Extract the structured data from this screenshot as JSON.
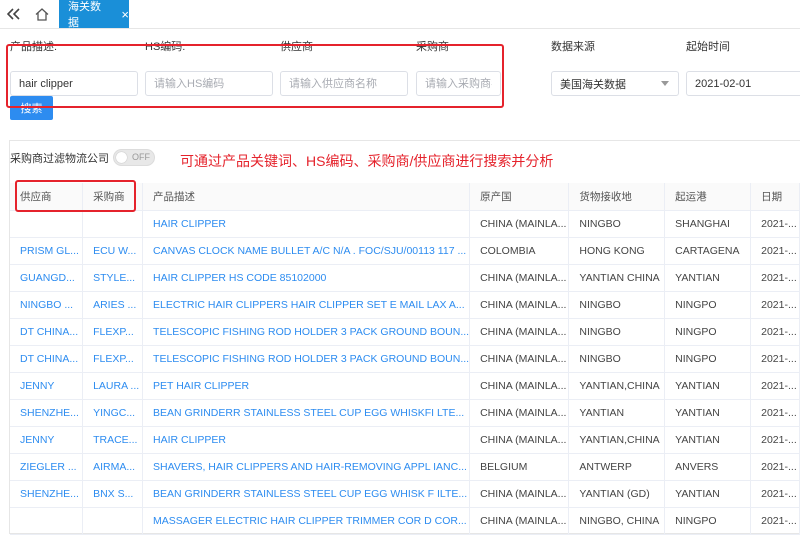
{
  "tabs": {
    "active_label": "海关数据",
    "close_glyph": "×"
  },
  "form": {
    "product_desc_label": "产品描述:",
    "hs_label": "HS编码:",
    "supplier_label": "供应商",
    "buyer_label": "采购商",
    "source_label": "数据来源",
    "start_label": "起始时间",
    "product_desc_value": "hair clipper",
    "hs_placeholder": "请输入HS编码",
    "supplier_placeholder": "请输入供应商名称",
    "buyer_placeholder": "请输入采购商名称",
    "source_value": "美国海关数据",
    "start_value": "2021-02-01",
    "search_label": "搜索"
  },
  "filter": {
    "label": "采购商过滤物流公司",
    "toggle_text": "OFF"
  },
  "annotation": "可通过产品关键词、HS编码、采购商/供应商进行搜索并分析",
  "colors": {
    "accent": "#2d8cf0",
    "highlight_red": "#e5232c"
  },
  "table": {
    "headers": [
      "供应商",
      "采购商",
      "产品描述",
      "原产国",
      "货物接收地",
      "起运港",
      "日期"
    ],
    "rows": [
      [
        "",
        "",
        "HAIR CLIPPER",
        "CHINA (MAINLA...",
        "NINGBO",
        "SHANGHAI",
        "2021-..."
      ],
      [
        "PRISM GL...",
        "ECU W...",
        "CANVAS CLOCK NAME BULLET A/C N/A . FOC/SJU/00113 117 ...",
        "COLOMBIA",
        "HONG KONG",
        "CARTAGENA",
        "2021-..."
      ],
      [
        "GUANGD...",
        "STYLE...",
        "HAIR CLIPPER HS CODE 85102000",
        "CHINA (MAINLA...",
        "YANTIAN CHINA",
        "YANTIAN",
        "2021-..."
      ],
      [
        "NINGBO ...",
        "ARIES ...",
        "ELECTRIC HAIR CLIPPERS HAIR CLIPPER SET E MAIL LAX A...",
        "CHINA (MAINLA...",
        "NINGBO",
        "NINGPO",
        "2021-..."
      ],
      [
        "DT CHINA...",
        "FLEXP...",
        "TELESCOPIC FISHING ROD HOLDER 3 PACK GROUND BOUN...",
        "CHINA (MAINLA...",
        "NINGBO",
        "NINGPO",
        "2021-..."
      ],
      [
        "DT CHINA...",
        "FLEXP...",
        "TELESCOPIC FISHING ROD HOLDER 3 PACK GROUND BOUN...",
        "CHINA (MAINLA...",
        "NINGBO",
        "NINGPO",
        "2021-..."
      ],
      [
        "JENNY",
        "LAURA ...",
        "PET HAIR CLIPPER",
        "CHINA (MAINLA...",
        "YANTIAN,CHINA",
        "YANTIAN",
        "2021-..."
      ],
      [
        "SHENZHE...",
        "YINGC...",
        "BEAN GRINDERR STAINLESS STEEL CUP EGG WHISKFI LTE...",
        "CHINA (MAINLA...",
        "YANTIAN",
        "YANTIAN",
        "2021-..."
      ],
      [
        "JENNY",
        "TRACE...",
        "HAIR CLIPPER",
        "CHINA (MAINLA...",
        "YANTIAN,CHINA",
        "YANTIAN",
        "2021-..."
      ],
      [
        "ZIEGLER ...",
        "AIRMA...",
        "SHAVERS, HAIR CLIPPERS AND HAIR-REMOVING APPL IANC...",
        "BELGIUM",
        "ANTWERP",
        "ANVERS",
        "2021-..."
      ],
      [
        "SHENZHE...",
        "BNX S...",
        "BEAN GRINDERR STAINLESS STEEL CUP EGG WHISK F ILTE...",
        "CHINA (MAINLA...",
        "YANTIAN (GD)",
        "YANTIAN",
        "2021-..."
      ],
      [
        "",
        "",
        "MASSAGER ELECTRIC HAIR CLIPPER TRIMMER COR D COR...",
        "CHINA (MAINLA...",
        "NINGBO, CHINA",
        "NINGPO",
        "2021-..."
      ]
    ]
  }
}
